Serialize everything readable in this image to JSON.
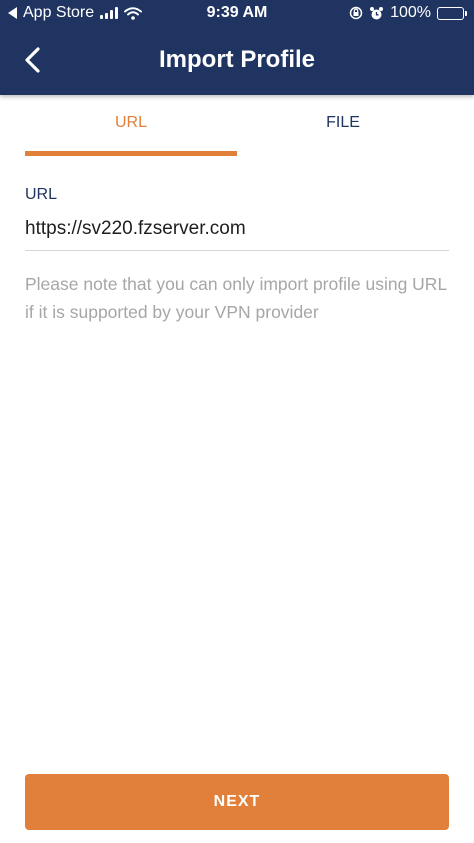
{
  "status_bar": {
    "back_app": "App Store",
    "time": "9:39 AM",
    "battery": "100%",
    "battery_level": 1.0
  },
  "header": {
    "title": "Import Profile"
  },
  "tabs": [
    {
      "label": "URL",
      "active": true
    },
    {
      "label": "FILE",
      "active": false
    }
  ],
  "form": {
    "url_label": "URL",
    "url_value": "https://sv220.fzserver.com",
    "note": "Please note that you can only import profile using URL if it is supported by your VPN provider"
  },
  "actions": {
    "next_label": "NEXT"
  },
  "colors": {
    "header_bg": "#1f3460",
    "accent": "#e0803a",
    "text_muted": "#a6a6a6"
  },
  "icons": [
    "back-triangle-icon",
    "signal-icon",
    "wifi-icon",
    "rotation-lock-icon",
    "alarm-icon",
    "battery-icon",
    "chevron-left-icon"
  ]
}
